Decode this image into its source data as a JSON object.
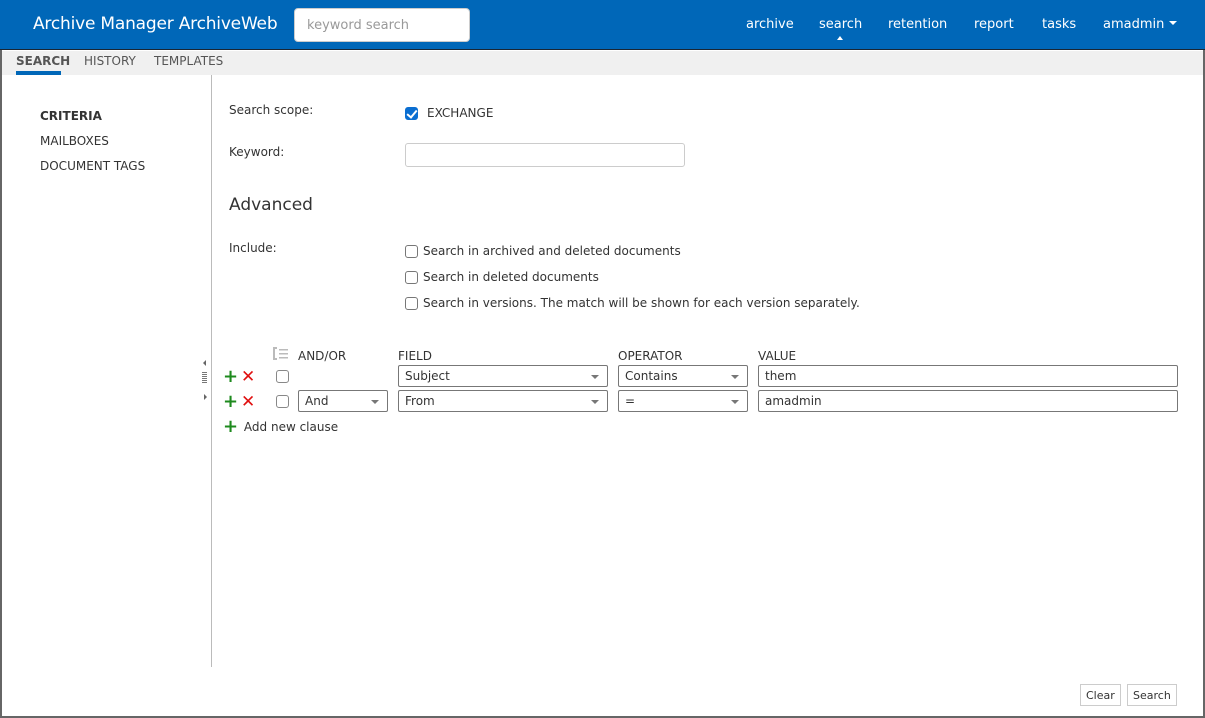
{
  "header": {
    "app_title": "Archive Manager ArchiveWeb",
    "search_placeholder": "keyword search",
    "search_value": "",
    "nav": [
      {
        "label": "archive",
        "active": false
      },
      {
        "label": "search",
        "active": true
      },
      {
        "label": "retention",
        "active": false
      },
      {
        "label": "report",
        "active": false
      },
      {
        "label": "tasks",
        "active": false
      }
    ],
    "user": "amadmin",
    "brand_color": "#0067b8"
  },
  "subtabs": [
    {
      "label": "SEARCH",
      "active": true
    },
    {
      "label": "HISTORY",
      "active": false
    },
    {
      "label": "TEMPLATES",
      "active": false
    }
  ],
  "sidebar": {
    "items": [
      {
        "label": "CRITERIA",
        "active": true
      },
      {
        "label": "MAILBOXES",
        "active": false
      },
      {
        "label": "DOCUMENT TAGS",
        "active": false
      }
    ]
  },
  "criteria": {
    "scope_label": "Search scope:",
    "scope_option": {
      "label": "EXCHANGE",
      "checked": true
    },
    "keyword_label": "Keyword:",
    "keyword_value": "",
    "advanced_title": "Advanced",
    "include_label": "Include:",
    "include_options": [
      {
        "label": "Search in archived and deleted documents",
        "checked": false
      },
      {
        "label": "Search in deleted documents",
        "checked": false
      },
      {
        "label": "Search in versions. The match will be shown for each version separately.",
        "checked": false
      }
    ]
  },
  "clauses": {
    "headers": {
      "andor": "AND/OR",
      "field": "FIELD",
      "operator": "OPERATOR",
      "value": "VALUE"
    },
    "rows": [
      {
        "andor": "",
        "field": "Subject",
        "operator": "Contains",
        "value": "them",
        "checked": false
      },
      {
        "andor": "And",
        "field": "From",
        "operator": "=",
        "value": "amadmin",
        "checked": false
      }
    ],
    "add_label": "Add new clause"
  },
  "footer": {
    "clear_label": "Clear",
    "search_label": "Search"
  }
}
